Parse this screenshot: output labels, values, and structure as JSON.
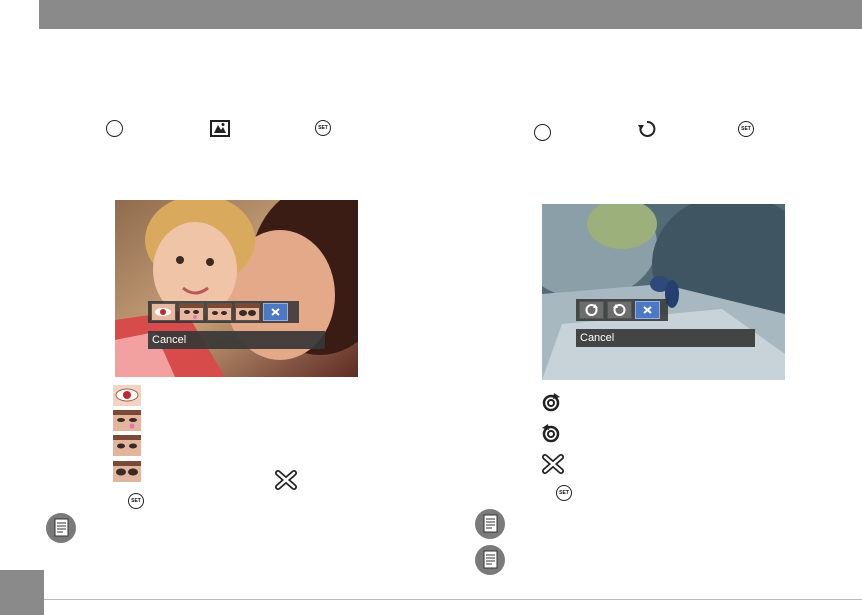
{
  "left": {
    "toolbar_icons": [
      "red-eye",
      "skin-retouch",
      "brighten-eyes",
      "enlarge-eyes",
      "cancel"
    ],
    "status_text": "Cancel",
    "set_label": "SET"
  },
  "right": {
    "toolbar_icons": [
      "rotate-right",
      "rotate-left",
      "cancel"
    ],
    "status_text": "Cancel",
    "set_label": "SET"
  },
  "colors": {
    "header": "#8a8a8a",
    "selected": "#4d78c4"
  }
}
